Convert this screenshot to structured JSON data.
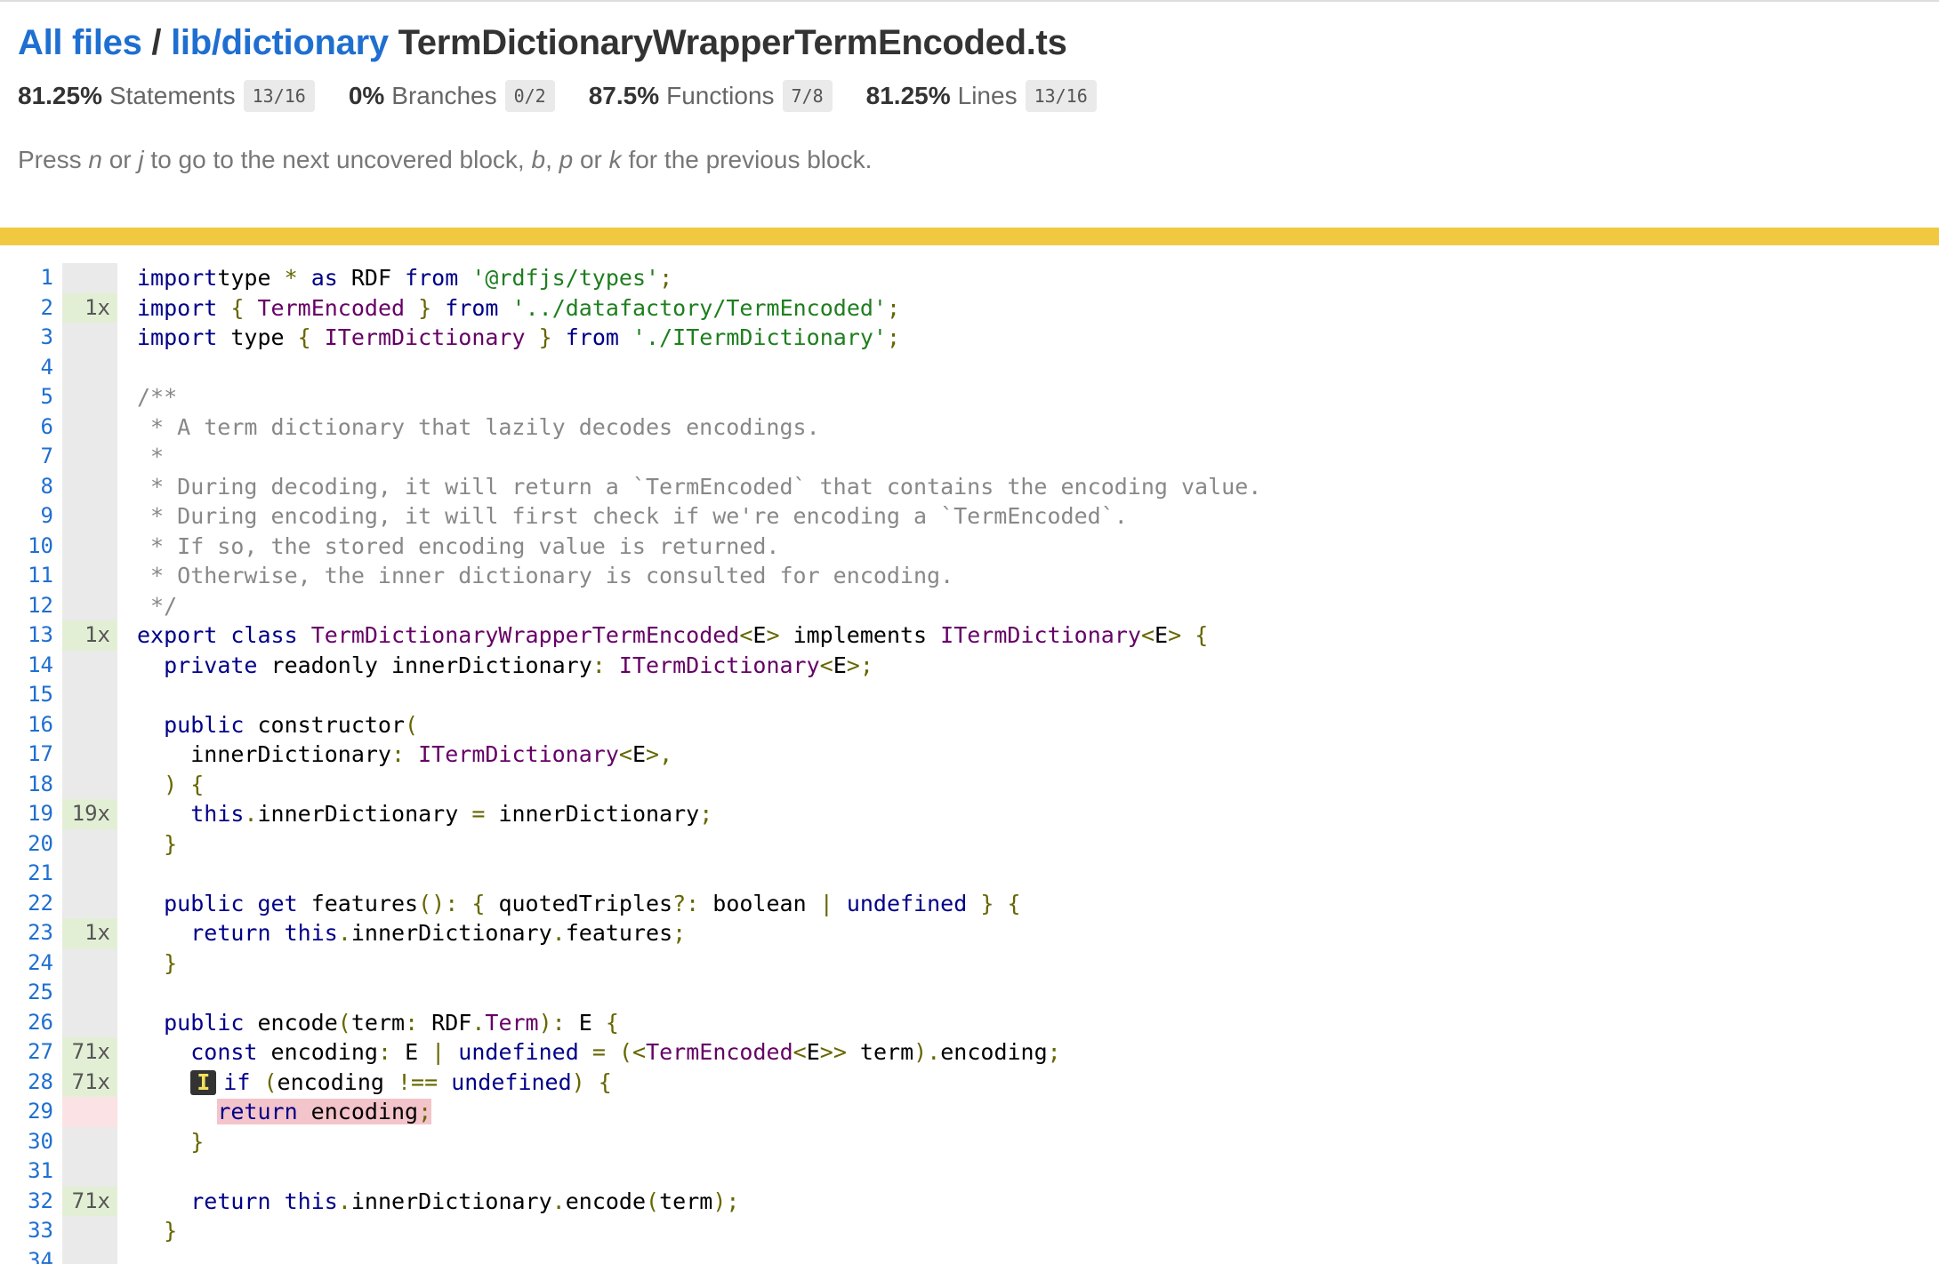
{
  "breadcrumb": {
    "all_files": "All files",
    "separator": "/",
    "folder": "lib/dictionary",
    "file": "TermDictionaryWrapperTermEncoded.ts"
  },
  "stats": [
    {
      "pct": "81.25%",
      "label": "Statements",
      "fraction": "13/16"
    },
    {
      "pct": "0%",
      "label": "Branches",
      "fraction": "0/2"
    },
    {
      "pct": "87.5%",
      "label": "Functions",
      "fraction": "7/8"
    },
    {
      "pct": "81.25%",
      "label": "Lines",
      "fraction": "13/16"
    }
  ],
  "hint": {
    "press": "Press",
    "n": "n",
    "or1": "or",
    "j": "j",
    "next_text": "to go to the next uncovered block,",
    "b": "b",
    "comma": ",",
    "p": "p",
    "or2": "or",
    "k": "k",
    "prev_text": "for the previous block."
  },
  "colors": {
    "status_bar": "#f1c940",
    "link": "#1f6fd1",
    "covered_count_bg": "#e3efd5",
    "uncovered_bg": "#f4c4cb"
  },
  "lines": [
    {
      "n": "1",
      "count": "",
      "cov": "neutral"
    },
    {
      "n": "2",
      "count": "1x",
      "cov": "yes"
    },
    {
      "n": "3",
      "count": "",
      "cov": "neutral"
    },
    {
      "n": "4",
      "count": "",
      "cov": "neutral"
    },
    {
      "n": "5",
      "count": "",
      "cov": "neutral"
    },
    {
      "n": "6",
      "count": "",
      "cov": "neutral"
    },
    {
      "n": "7",
      "count": "",
      "cov": "neutral"
    },
    {
      "n": "8",
      "count": "",
      "cov": "neutral"
    },
    {
      "n": "9",
      "count": "",
      "cov": "neutral"
    },
    {
      "n": "10",
      "count": "",
      "cov": "neutral"
    },
    {
      "n": "11",
      "count": "",
      "cov": "neutral"
    },
    {
      "n": "12",
      "count": "",
      "cov": "neutral"
    },
    {
      "n": "13",
      "count": "1x",
      "cov": "yes"
    },
    {
      "n": "14",
      "count": "",
      "cov": "neutral"
    },
    {
      "n": "15",
      "count": "",
      "cov": "neutral"
    },
    {
      "n": "16",
      "count": "",
      "cov": "neutral"
    },
    {
      "n": "17",
      "count": "",
      "cov": "neutral"
    },
    {
      "n": "18",
      "count": "",
      "cov": "neutral"
    },
    {
      "n": "19",
      "count": "19x",
      "cov": "yes"
    },
    {
      "n": "20",
      "count": "",
      "cov": "neutral"
    },
    {
      "n": "21",
      "count": "",
      "cov": "neutral"
    },
    {
      "n": "22",
      "count": "",
      "cov": "neutral"
    },
    {
      "n": "23",
      "count": "1x",
      "cov": "yes"
    },
    {
      "n": "24",
      "count": "",
      "cov": "neutral"
    },
    {
      "n": "25",
      "count": "",
      "cov": "neutral"
    },
    {
      "n": "26",
      "count": "",
      "cov": "neutral"
    },
    {
      "n": "27",
      "count": "71x",
      "cov": "yes"
    },
    {
      "n": "28",
      "count": "71x",
      "cov": "yes"
    },
    {
      "n": "29",
      "count": "",
      "cov": "no"
    },
    {
      "n": "30",
      "count": "",
      "cov": "neutral"
    },
    {
      "n": "31",
      "count": "",
      "cov": "neutral"
    },
    {
      "n": "32",
      "count": "71x",
      "cov": "yes"
    },
    {
      "n": "33",
      "count": "",
      "cov": "neutral"
    },
    {
      "n": "34",
      "count": "",
      "cov": "neutral"
    }
  ],
  "code": {
    "l1": [
      [
        "kw",
        "import"
      ],
      [
        "",
        "type "
      ],
      [
        "pn",
        "*"
      ],
      [
        "kw",
        " as"
      ],
      [
        "",
        " RDF "
      ],
      [
        "kw",
        "from"
      ],
      [
        "",
        " "
      ],
      [
        "str",
        "'@rdfjs/types'"
      ],
      [
        "pn",
        ";"
      ]
    ],
    "l2": [
      [
        "kw",
        "import"
      ],
      [
        "",
        " "
      ],
      [
        "pn",
        "{"
      ],
      [
        "",
        " "
      ],
      [
        "ty",
        "TermEncoded"
      ],
      [
        "",
        " "
      ],
      [
        "pn",
        "}"
      ],
      [
        "",
        " "
      ],
      [
        "kw",
        "from"
      ],
      [
        "",
        " "
      ],
      [
        "str",
        "'../datafactory/TermEncoded'"
      ],
      [
        "pn",
        ";"
      ]
    ],
    "l3": [
      [
        "kw",
        "import"
      ],
      [
        "",
        " type "
      ],
      [
        "pn",
        "{"
      ],
      [
        "",
        " "
      ],
      [
        "ty",
        "ITermDictionary"
      ],
      [
        "",
        " "
      ],
      [
        "pn",
        "}"
      ],
      [
        "",
        " "
      ],
      [
        "kw",
        "from"
      ],
      [
        "",
        " "
      ],
      [
        "str",
        "'./ITermDictionary'"
      ],
      [
        "pn",
        ";"
      ]
    ],
    "l4": [],
    "l5": [
      [
        "cm",
        "/**"
      ]
    ],
    "l6": [
      [
        "cm",
        " * A term dictionary that lazily decodes encodings."
      ]
    ],
    "l7": [
      [
        "cm",
        " *"
      ]
    ],
    "l8": [
      [
        "cm",
        " * During decoding, it will return a `TermEncoded` that contains the encoding value."
      ]
    ],
    "l9": [
      [
        "cm",
        " * During encoding, it will first check if we're encoding a `TermEncoded`."
      ]
    ],
    "l10": [
      [
        "cm",
        " * If so, the stored encoding value is returned."
      ]
    ],
    "l11": [
      [
        "cm",
        " * Otherwise, the inner dictionary is consulted for encoding."
      ]
    ],
    "l12": [
      [
        "cm",
        " */"
      ]
    ],
    "l13": [
      [
        "kw",
        "export"
      ],
      [
        "",
        " "
      ],
      [
        "kw",
        "class"
      ],
      [
        "",
        " "
      ],
      [
        "ty",
        "TermDictionaryWrapperTermEncoded"
      ],
      [
        "pn",
        "<"
      ],
      [
        "",
        "E"
      ],
      [
        "pn",
        ">"
      ],
      [
        "",
        " implements "
      ],
      [
        "ty",
        "ITermDictionary"
      ],
      [
        "pn",
        "<"
      ],
      [
        "",
        "E"
      ],
      [
        "pn",
        ">"
      ],
      [
        "",
        " "
      ],
      [
        "pn",
        "{"
      ]
    ],
    "l14": [
      [
        "",
        "  "
      ],
      [
        "kw",
        "private"
      ],
      [
        "",
        " readonly innerDictionary"
      ],
      [
        "pn",
        ":"
      ],
      [
        "",
        " "
      ],
      [
        "ty",
        "ITermDictionary"
      ],
      [
        "pn",
        "<"
      ],
      [
        "",
        "E"
      ],
      [
        "pn",
        ">;"
      ]
    ],
    "l15": [],
    "l16": [
      [
        "",
        "  "
      ],
      [
        "kw",
        "public"
      ],
      [
        "",
        " constructor"
      ],
      [
        "pn",
        "("
      ]
    ],
    "l17": [
      [
        "",
        "    innerDictionary"
      ],
      [
        "pn",
        ":"
      ],
      [
        "",
        " "
      ],
      [
        "ty",
        "ITermDictionary"
      ],
      [
        "pn",
        "<"
      ],
      [
        "",
        "E"
      ],
      [
        "pn",
        ">,"
      ]
    ],
    "l18": [
      [
        "",
        "  "
      ],
      [
        "pn",
        ")"
      ],
      [
        "",
        " "
      ],
      [
        "pn",
        "{"
      ]
    ],
    "l19": [
      [
        "",
        "    "
      ],
      [
        "kw",
        "this"
      ],
      [
        "pn",
        "."
      ],
      [
        "",
        "innerDictionary "
      ],
      [
        "pn",
        "="
      ],
      [
        "",
        " innerDictionary"
      ],
      [
        "pn",
        ";"
      ]
    ],
    "l20": [
      [
        "",
        "  "
      ],
      [
        "pn",
        "}"
      ]
    ],
    "l21": [],
    "l22": [
      [
        "",
        "  "
      ],
      [
        "kw",
        "public"
      ],
      [
        "",
        " "
      ],
      [
        "kw",
        "get"
      ],
      [
        "",
        " features"
      ],
      [
        "pn",
        "():"
      ],
      [
        "",
        " "
      ],
      [
        "pn",
        "{"
      ],
      [
        "",
        " quotedTriples"
      ],
      [
        "pn",
        "?:"
      ],
      [
        "",
        " boolean "
      ],
      [
        "pn",
        "|"
      ],
      [
        "",
        " "
      ],
      [
        "kw",
        "undefined"
      ],
      [
        "",
        " "
      ],
      [
        "pn",
        "}"
      ],
      [
        "",
        " "
      ],
      [
        "pn",
        "{"
      ]
    ],
    "l23": [
      [
        "",
        "    "
      ],
      [
        "kw",
        "return"
      ],
      [
        "",
        " "
      ],
      [
        "kw",
        "this"
      ],
      [
        "pn",
        "."
      ],
      [
        "",
        "innerDictionary"
      ],
      [
        "pn",
        "."
      ],
      [
        "",
        "features"
      ],
      [
        "pn",
        ";"
      ]
    ],
    "l24": [
      [
        "",
        "  "
      ],
      [
        "pn",
        "}"
      ]
    ],
    "l25": [],
    "l26": [
      [
        "",
        "  "
      ],
      [
        "kw",
        "public"
      ],
      [
        "",
        " encode"
      ],
      [
        "pn",
        "("
      ],
      [
        "",
        "term"
      ],
      [
        "pn",
        ":"
      ],
      [
        "",
        " RDF"
      ],
      [
        "pn",
        "."
      ],
      [
        "ty",
        "Term"
      ],
      [
        "pn",
        "):"
      ],
      [
        "",
        " E "
      ],
      [
        "pn",
        "{"
      ]
    ],
    "l27": [
      [
        "",
        "    "
      ],
      [
        "kw",
        "const"
      ],
      [
        "",
        " encoding"
      ],
      [
        "pn",
        ":"
      ],
      [
        "",
        " E "
      ],
      [
        "pn",
        "|"
      ],
      [
        "",
        " "
      ],
      [
        "kw",
        "undefined"
      ],
      [
        "",
        " "
      ],
      [
        "pn",
        "="
      ],
      [
        "",
        " "
      ],
      [
        "pn",
        "(<"
      ],
      [
        "ty",
        "TermEncoded"
      ],
      [
        "pn",
        "<"
      ],
      [
        "",
        "E"
      ],
      [
        "pn",
        ">>"
      ],
      [
        "",
        " term"
      ],
      [
        "pn",
        ")."
      ],
      [
        "",
        "encoding"
      ],
      [
        "pn",
        ";"
      ]
    ],
    "l28": [
      [
        "",
        "    "
      ],
      [
        "mark",
        "I"
      ],
      [
        "kw",
        "if"
      ],
      [
        "",
        " "
      ],
      [
        "pn",
        "("
      ],
      [
        "",
        "encoding "
      ],
      [
        "pn",
        "!=="
      ],
      [
        "",
        " "
      ],
      [
        "kw",
        "undefined"
      ],
      [
        "pn",
        ")"
      ],
      [
        "",
        " "
      ],
      [
        "pn",
        "{"
      ]
    ],
    "l29": [
      [
        "",
        "      "
      ],
      [
        "ukw",
        "return"
      ],
      [
        "u",
        " encoding"
      ],
      [
        "upn",
        ";"
      ]
    ],
    "l30": [
      [
        "",
        "    "
      ],
      [
        "pn",
        "}"
      ]
    ],
    "l31": [],
    "l32": [
      [
        "",
        "    "
      ],
      [
        "kw",
        "return"
      ],
      [
        "",
        " "
      ],
      [
        "kw",
        "this"
      ],
      [
        "pn",
        "."
      ],
      [
        "",
        "innerDictionary"
      ],
      [
        "pn",
        "."
      ],
      [
        "",
        "encode"
      ],
      [
        "pn",
        "("
      ],
      [
        "",
        "term"
      ],
      [
        "pn",
        ");"
      ]
    ],
    "l33": [
      [
        "",
        "  "
      ],
      [
        "pn",
        "}"
      ]
    ],
    "l34": []
  }
}
